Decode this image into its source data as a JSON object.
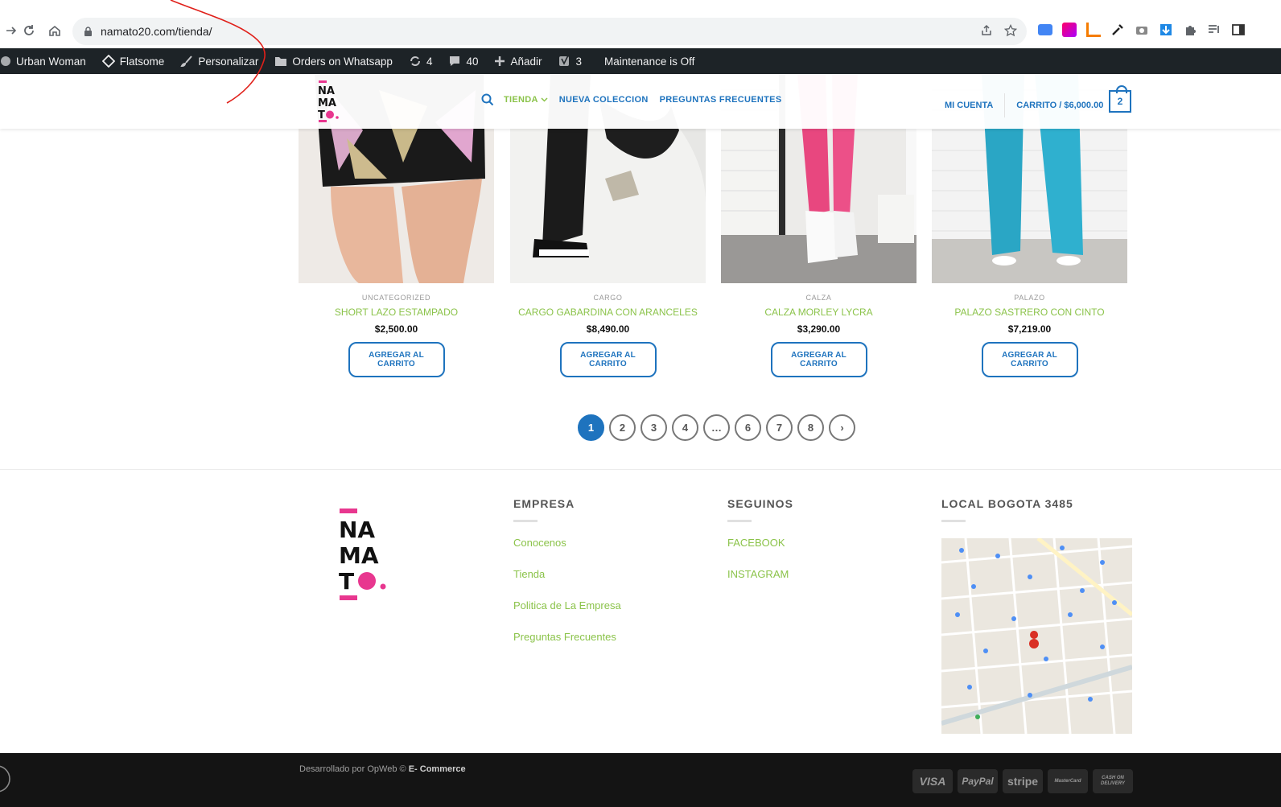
{
  "browser": {
    "url": "namato20.com/tienda/"
  },
  "admin_bar": {
    "site_name": "Urban Woman",
    "theme": "Flatsome",
    "customize": "Personalizar",
    "orders": "Orders on Whatsapp",
    "updates_count": "4",
    "comments_count": "40",
    "add_new": "Añadir",
    "yoast_count": "3",
    "maintenance": "Maintenance is Off"
  },
  "header": {
    "logo_text": [
      "NA",
      "MA",
      "TO"
    ],
    "nav": [
      {
        "label": "TIENDA",
        "active": true
      },
      {
        "label": "NUEVA COLECCION",
        "active": false
      },
      {
        "label": "PREGUNTAS FRECUENTES",
        "active": false
      }
    ],
    "account": "MI CUENTA",
    "cart": "CARRITO / $6,000.00",
    "cart_count": "2"
  },
  "products": [
    {
      "category": "UNCATEGORIZED",
      "title": "SHORT LAZO ESTAMPADO",
      "price": "$2,500.00",
      "button": "AGREGAR AL CARRITO"
    },
    {
      "category": "CARGO",
      "title": "CARGO GABARDINA CON ARANCELES",
      "price": "$8,490.00",
      "button": "AGREGAR AL CARRITO"
    },
    {
      "category": "CALZA",
      "title": "CALZA MORLEY LYCRA",
      "price": "$3,290.00",
      "button": "AGREGAR AL CARRITO"
    },
    {
      "category": "PALAZO",
      "title": "PALAZO SASTRERO CON CINTO",
      "price": "$7,219.00",
      "button": "AGREGAR AL CARRITO"
    }
  ],
  "pagination": [
    "1",
    "2",
    "3",
    "4",
    "…",
    "6",
    "7",
    "8",
    "›"
  ],
  "footer": {
    "col1": {
      "title": "EMPRESA",
      "links": [
        "Conocenos",
        "Tienda",
        "Politica de La Empresa",
        "Preguntas Frecuentes"
      ]
    },
    "col2": {
      "title": "SEGUINOS",
      "links": [
        "FACEBOOK",
        "INSTAGRAM"
      ]
    },
    "col3": {
      "title": "LOCAL BOGOTA 3485"
    },
    "credit_prefix": "Desarrollado por OpWeb ©",
    "credit_suffix": "E- Commerce",
    "payments": [
      "VISA",
      "PayPal",
      "stripe",
      "MasterCard",
      "CASH ON DELIVERY"
    ]
  },
  "colors": {
    "accent_blue": "#1e73be",
    "accent_green": "#8bc34a",
    "brand_pink": "#e8378f",
    "admin_bar": "#1d2327"
  }
}
